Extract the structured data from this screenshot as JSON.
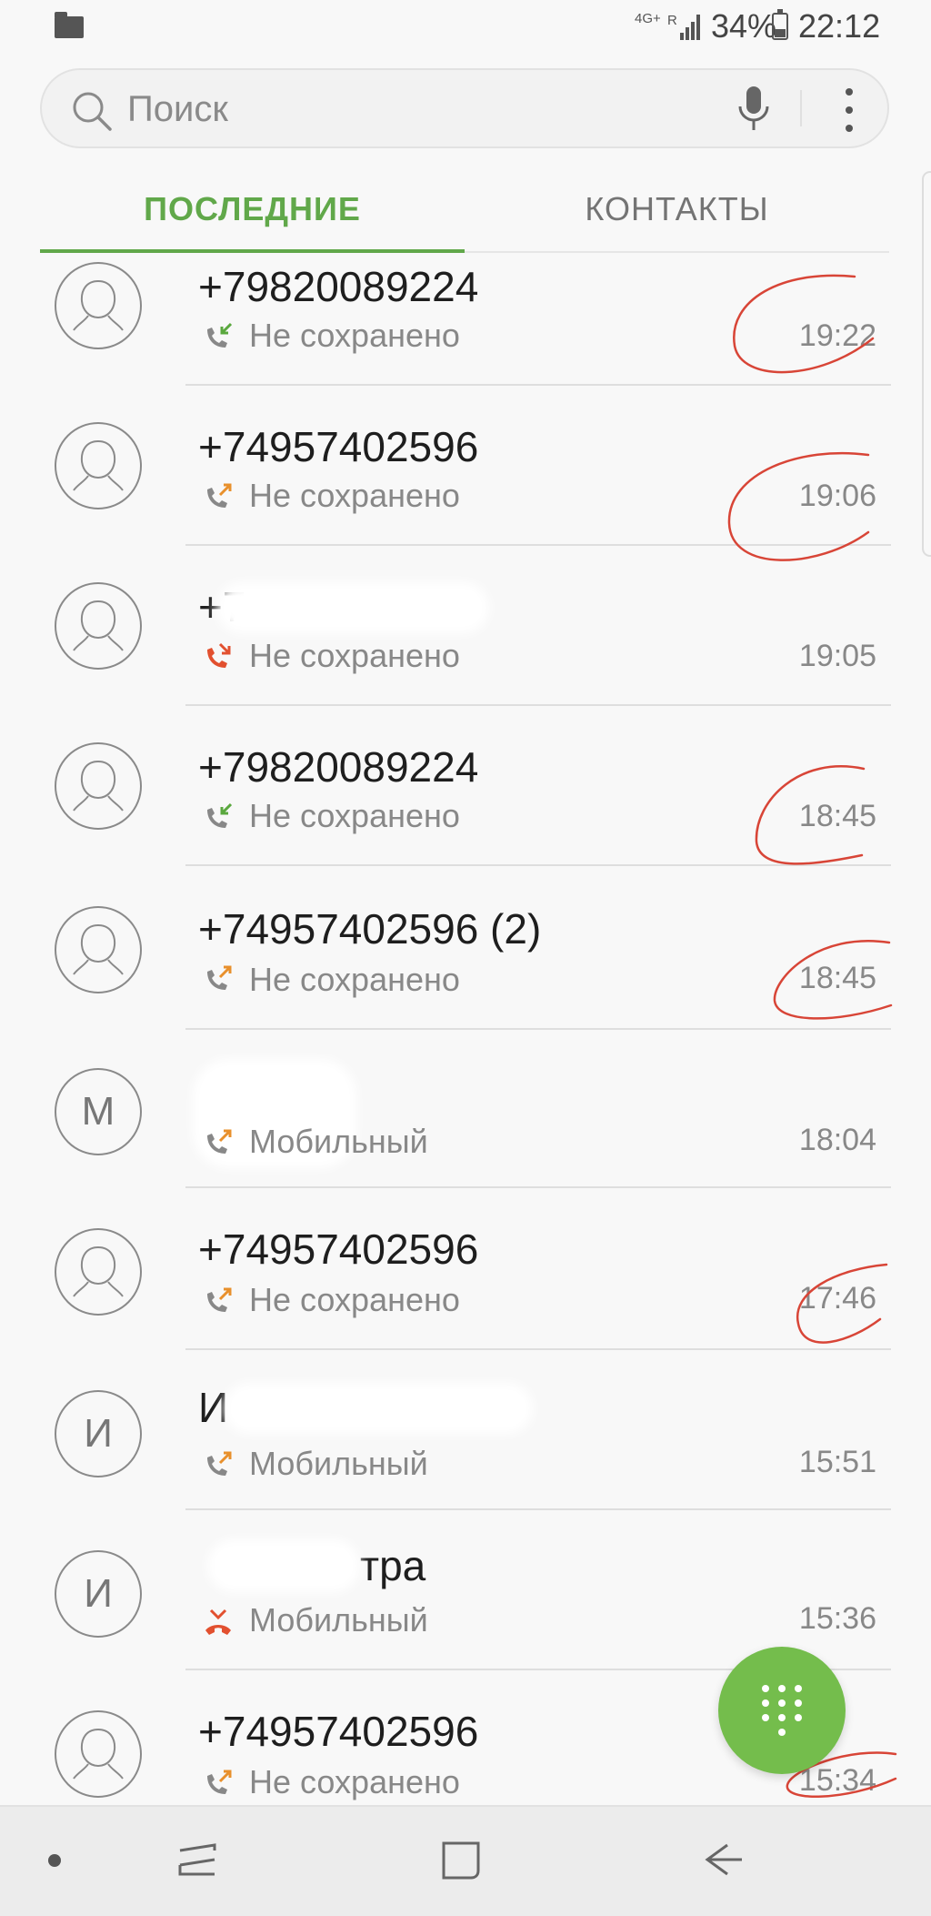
{
  "status": {
    "network": "4G+",
    "roaming": "R",
    "battery": "34%",
    "time": "22:12"
  },
  "search": {
    "placeholder": "Поиск"
  },
  "tabs": [
    {
      "label": "ПОСЛЕДНИЕ"
    },
    {
      "label": "КОНТАКТЫ"
    }
  ],
  "calls": [
    {
      "name": "+79820089224",
      "detail": "Не сохранено",
      "time": "19:22",
      "call_type": "incoming",
      "avatar": "person-icon"
    },
    {
      "name": "+74957402596",
      "detail": "Не сохранено",
      "time": "19:06",
      "call_type": "outgoing",
      "avatar": "person-icon"
    },
    {
      "name": "+7",
      "detail": "Не сохранено",
      "time": "19:05",
      "call_type": "missed",
      "avatar": "person-icon"
    },
    {
      "name": "+79820089224",
      "detail": "Не сохранено",
      "time": "18:45",
      "call_type": "incoming",
      "avatar": "person-icon"
    },
    {
      "name": "+74957402596 (2)",
      "detail": "Не сохранено",
      "time": "18:45",
      "call_type": "outgoing",
      "avatar": "person-icon"
    },
    {
      "name": "",
      "detail": "Мобильный",
      "time": "18:04",
      "call_type": "outgoing",
      "avatar": "М"
    },
    {
      "name": "+74957402596",
      "detail": "Не сохранено",
      "time": "17:46",
      "call_type": "outgoing",
      "avatar": "person-icon"
    },
    {
      "name": "И",
      "detail": "Мобильный",
      "time": "15:51",
      "call_type": "outgoing",
      "avatar": "И"
    },
    {
      "name": "тра",
      "detail": "Мобильный",
      "time": "15:36",
      "call_type": "rejected",
      "avatar": "И"
    },
    {
      "name": "+74957402596",
      "detail": "Не сохранено",
      "time": "15:34",
      "call_type": "outgoing",
      "avatar": "person-icon"
    }
  ],
  "colors": {
    "accent": "#61a84a",
    "fab": "#74bd4c",
    "annotation": "#d84537",
    "missed": "#e2502f",
    "outgoing": "#e8902c",
    "incoming": "#5aa83e"
  }
}
